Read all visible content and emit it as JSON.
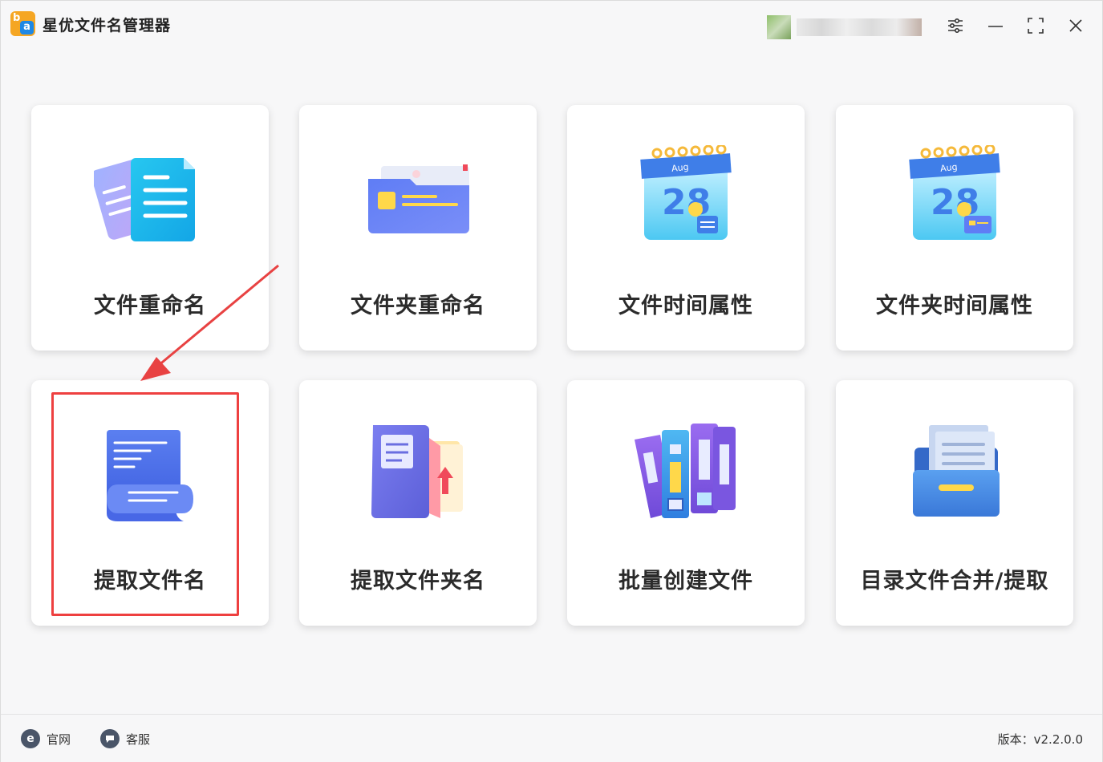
{
  "app": {
    "title": "星优文件名管理器",
    "logo_letters": {
      "b": "b",
      "a": "a"
    }
  },
  "window_controls": {
    "settings_icon": "sliders-icon",
    "minimize_icon": "minimize-icon",
    "maximize_icon": "maximize-icon",
    "close_icon": "close-icon"
  },
  "cards": [
    {
      "label": "文件重命名",
      "icon": "document-icon"
    },
    {
      "label": "文件夹重命名",
      "icon": "folder-icon"
    },
    {
      "label": "文件时间属性",
      "icon": "calendar-icon",
      "calendar_month": "Aug",
      "calendar_day": "28"
    },
    {
      "label": "文件夹时间属性",
      "icon": "calendar-folder-icon",
      "calendar_month": "Aug",
      "calendar_day": "28"
    },
    {
      "label": "提取文件名",
      "icon": "scroll-icon"
    },
    {
      "label": "提取文件夹名",
      "icon": "folder-extract-icon"
    },
    {
      "label": "批量创建文件",
      "icon": "binders-icon"
    },
    {
      "label": "目录文件合并/提取",
      "icon": "file-drawer-icon"
    }
  ],
  "footer": {
    "website": "官网",
    "service": "客服",
    "version": "版本：v2.2.0.0"
  },
  "colors": {
    "highlight": "#ee4040",
    "accent_blue": "#2f80ed",
    "logo_orange": "#f5a623"
  }
}
